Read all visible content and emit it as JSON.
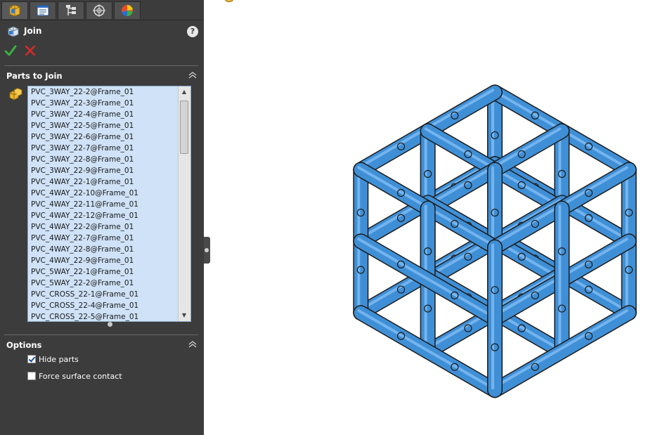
{
  "tabs": [
    {
      "name": "feature-manager-tab",
      "icon": "feature-manager-icon",
      "active": true
    },
    {
      "name": "property-manager-tab",
      "icon": "property-manager-icon",
      "active": false
    },
    {
      "name": "configuration-manager-tab",
      "icon": "configuration-manager-icon",
      "active": false
    },
    {
      "name": "dimxpert-manager-tab",
      "icon": "dimxpert-icon",
      "active": false
    },
    {
      "name": "display-manager-tab",
      "icon": "display-manager-icon",
      "active": false
    }
  ],
  "header": {
    "title": "Join",
    "help": "?"
  },
  "parts_section": {
    "title": "Parts to Join",
    "items": [
      "PVC_3WAY_22-2@Frame_01",
      "PVC_3WAY_22-3@Frame_01",
      "PVC_3WAY_22-4@Frame_01",
      "PVC_3WAY_22-5@Frame_01",
      "PVC_3WAY_22-6@Frame_01",
      "PVC_3WAY_22-7@Frame_01",
      "PVC_3WAY_22-8@Frame_01",
      "PVC_3WAY_22-9@Frame_01",
      "PVC_4WAY_22-1@Frame_01",
      "PVC_4WAY_22-10@Frame_01",
      "PVC_4WAY_22-11@Frame_01",
      "PVC_4WAY_22-12@Frame_01",
      "PVC_4WAY_22-2@Frame_01",
      "PVC_4WAY_22-7@Frame_01",
      "PVC_4WAY_22-8@Frame_01",
      "PVC_4WAY_22-9@Frame_01",
      "PVC_5WAY_22-1@Frame_01",
      "PVC_5WAY_22-2@Frame_01",
      "PVC_CROSS_22-1@Frame_01",
      "PVC_CROSS_22-4@Frame_01",
      "PVC_CROSS_22-5@Frame_01"
    ]
  },
  "options_section": {
    "title": "Options",
    "hide_parts": {
      "label": "Hide parts",
      "checked": true
    },
    "force_contact": {
      "label": "Force surface contact",
      "checked": false
    }
  },
  "colors": {
    "panel": "#3c3c3c",
    "list_bg": "#cfe2f7",
    "pipe": "#3f8fd6",
    "accept": "#3cb043",
    "cancel": "#d62b2b"
  }
}
